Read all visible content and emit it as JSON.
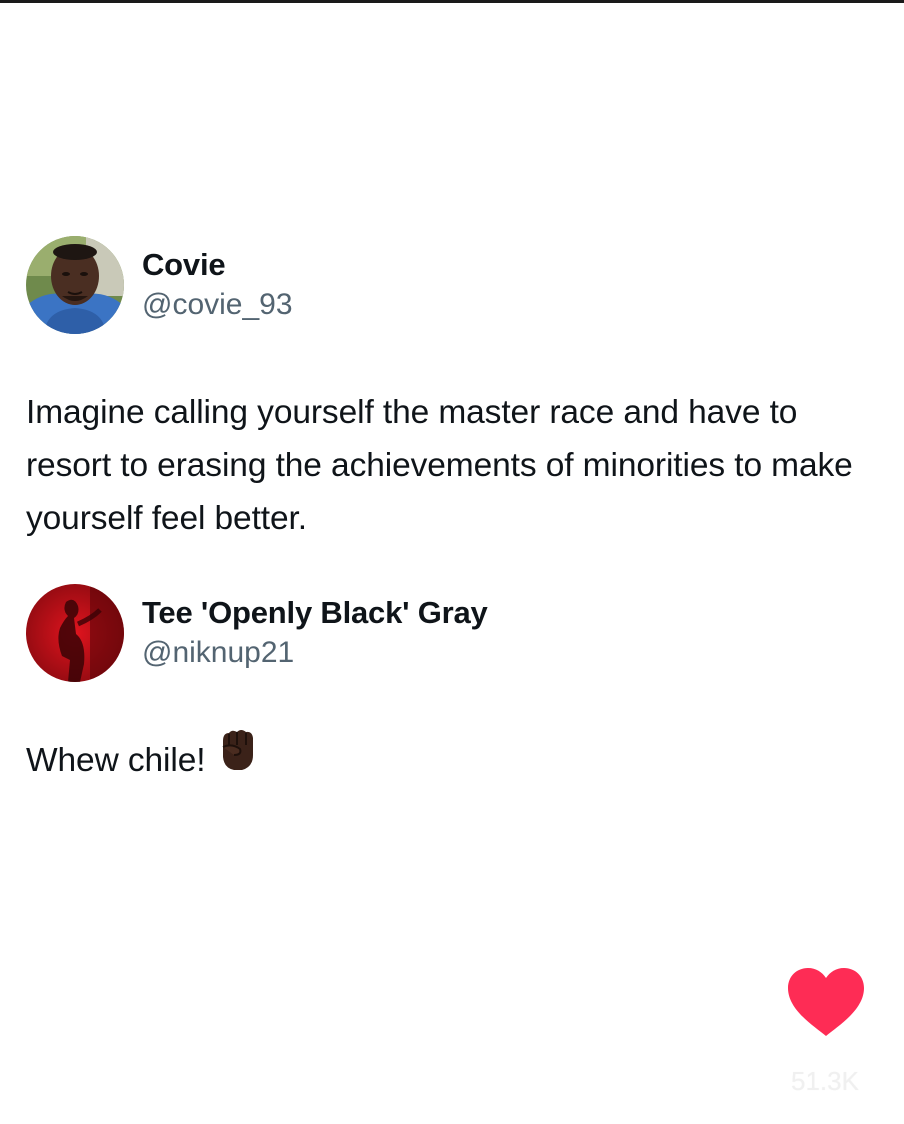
{
  "posts": [
    {
      "display_name": "Covie",
      "handle": "@covie_93",
      "avatar": "person-photo-avatar",
      "text": "Imagine calling yourself the master race and have to resort to erasing the achievements of minorities to make yourself feel better."
    },
    {
      "display_name": "Tee 'Openly Black' Gray",
      "handle": "@niknup21",
      "avatar": "red-silhouette-avatar",
      "text": "Whew chile!",
      "emoji": "raised-fist-icon"
    }
  ],
  "like": {
    "icon": "heart-icon",
    "count": "51.3K",
    "color": "#fe2c55"
  },
  "colors": {
    "text": "#0f1419",
    "handle": "#536471"
  }
}
